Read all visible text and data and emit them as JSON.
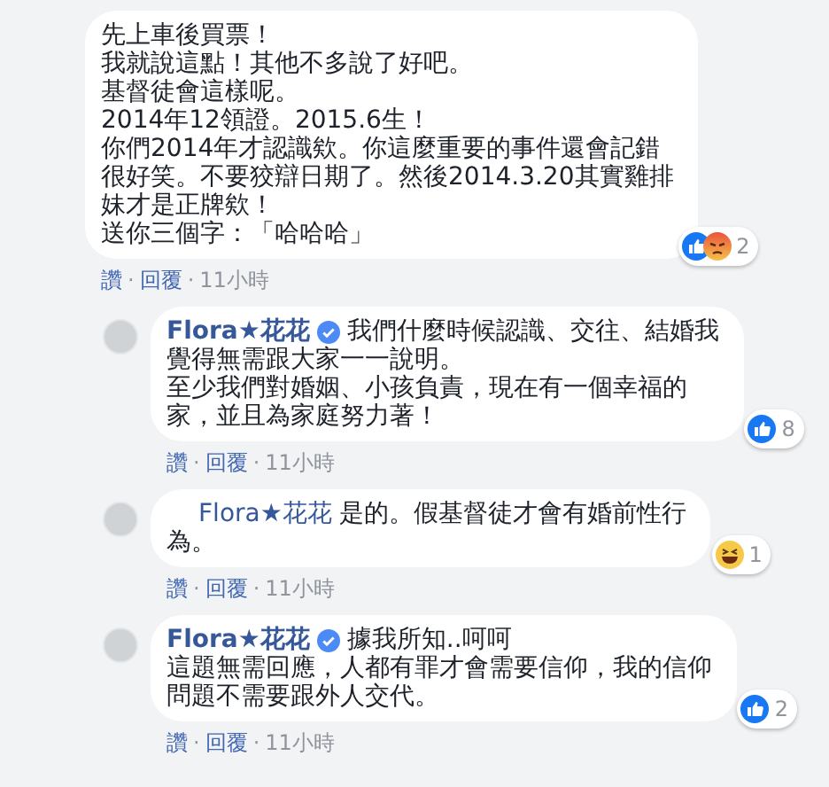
{
  "comments": [
    {
      "kind": "top",
      "lines": [
        "先上車後買票！",
        "我就說這點！其他不多說了好吧。",
        "基督徒會這樣呢。",
        "2014年12領證。2015.6生！",
        "你們2014年才認識欸。你這麼重要的事件還會記錯",
        "很好笑。不要狡辯日期了。然後2014.3.20其實雞排",
        "妹才是正牌欸！",
        "送你三個字：「哈哈哈」"
      ],
      "reactions": {
        "icons": [
          {
            "kind": "like"
          },
          {
            "kind": "angry"
          }
        ],
        "count": "2"
      },
      "footer": [
        {
          "kind": "link",
          "text": "讚"
        },
        {
          "kind": "dot",
          "text": "·"
        },
        {
          "kind": "link",
          "text": "回覆"
        },
        {
          "kind": "dot",
          "text": "·"
        },
        {
          "kind": "time",
          "text": "11小時"
        }
      ]
    },
    {
      "kind": "reply",
      "author": "Flora★花花",
      "verified": true,
      "lines": [
        "我們什麼時候認識、交往、結婚我",
        "覺得無需跟大家一一說明。",
        "至少我們對婚姻、小孩負責，現在有一個幸福的",
        "家，並且為家庭努力著！"
      ],
      "reactions": {
        "icons": [
          {
            "kind": "like"
          }
        ],
        "count": "8"
      },
      "footer": [
        {
          "kind": "link",
          "text": "讚"
        },
        {
          "kind": "dot",
          "text": "·"
        },
        {
          "kind": "link",
          "text": "回覆"
        },
        {
          "kind": "dot",
          "text": "·"
        },
        {
          "kind": "time",
          "text": "11小時"
        }
      ]
    },
    {
      "kind": "reply",
      "mention": "Flora★花花",
      "lines": [
        "是的。假基督徒才會有婚前性行",
        "為。"
      ],
      "reactions": {
        "icons": [
          {
            "kind": "haha"
          }
        ],
        "count": "1"
      },
      "footer": [
        {
          "kind": "link",
          "text": "讚"
        },
        {
          "kind": "dot",
          "text": "·"
        },
        {
          "kind": "link",
          "text": "回覆"
        },
        {
          "kind": "dot",
          "text": "·"
        },
        {
          "kind": "time",
          "text": "11小時"
        }
      ]
    },
    {
      "kind": "reply",
      "author": "Flora★花花",
      "verified": true,
      "lines": [
        "據我所知..呵呵",
        "這題無需回應，人都有罪才會需要信仰，我的信仰",
        "問題不需要跟外人交代。"
      ],
      "reactions": {
        "icons": [
          {
            "kind": "like"
          }
        ],
        "count": "2"
      },
      "footer": [
        {
          "kind": "link",
          "text": "讚"
        },
        {
          "kind": "dot",
          "text": "·"
        },
        {
          "kind": "link",
          "text": "回覆"
        },
        {
          "kind": "dot",
          "text": "·"
        },
        {
          "kind": "time",
          "text": "11小時"
        }
      ]
    }
  ]
}
